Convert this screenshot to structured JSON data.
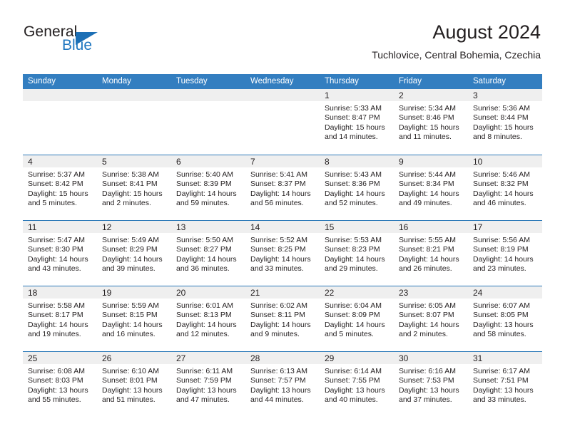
{
  "brand": {
    "name_top": "General",
    "name_bottom": "Blue",
    "accent_color": "#2077c0",
    "triangle_color": "#1c6fb5"
  },
  "header": {
    "title": "August 2024",
    "subtitle": "Tuchlovice, Central Bohemia, Czechia"
  },
  "calendar": {
    "header_background": "#337ec0",
    "header_text_color": "#ffffff",
    "day_band_background": "#efefef",
    "weekdays": [
      "Sunday",
      "Monday",
      "Tuesday",
      "Wednesday",
      "Thursday",
      "Friday",
      "Saturday"
    ],
    "weeks": [
      [
        {
          "day": "",
          "empty": true
        },
        {
          "day": "",
          "empty": true
        },
        {
          "day": "",
          "empty": true
        },
        {
          "day": "",
          "empty": true
        },
        {
          "day": "1",
          "sunrise": "Sunrise: 5:33 AM",
          "sunset": "Sunset: 8:47 PM",
          "daylight_line1": "Daylight: 15 hours",
          "daylight_line2": "and 14 minutes."
        },
        {
          "day": "2",
          "sunrise": "Sunrise: 5:34 AM",
          "sunset": "Sunset: 8:46 PM",
          "daylight_line1": "Daylight: 15 hours",
          "daylight_line2": "and 11 minutes."
        },
        {
          "day": "3",
          "sunrise": "Sunrise: 5:36 AM",
          "sunset": "Sunset: 8:44 PM",
          "daylight_line1": "Daylight: 15 hours",
          "daylight_line2": "and 8 minutes."
        }
      ],
      [
        {
          "day": "4",
          "sunrise": "Sunrise: 5:37 AM",
          "sunset": "Sunset: 8:42 PM",
          "daylight_line1": "Daylight: 15 hours",
          "daylight_line2": "and 5 minutes."
        },
        {
          "day": "5",
          "sunrise": "Sunrise: 5:38 AM",
          "sunset": "Sunset: 8:41 PM",
          "daylight_line1": "Daylight: 15 hours",
          "daylight_line2": "and 2 minutes."
        },
        {
          "day": "6",
          "sunrise": "Sunrise: 5:40 AM",
          "sunset": "Sunset: 8:39 PM",
          "daylight_line1": "Daylight: 14 hours",
          "daylight_line2": "and 59 minutes."
        },
        {
          "day": "7",
          "sunrise": "Sunrise: 5:41 AM",
          "sunset": "Sunset: 8:37 PM",
          "daylight_line1": "Daylight: 14 hours",
          "daylight_line2": "and 56 minutes."
        },
        {
          "day": "8",
          "sunrise": "Sunrise: 5:43 AM",
          "sunset": "Sunset: 8:36 PM",
          "daylight_line1": "Daylight: 14 hours",
          "daylight_line2": "and 52 minutes."
        },
        {
          "day": "9",
          "sunrise": "Sunrise: 5:44 AM",
          "sunset": "Sunset: 8:34 PM",
          "daylight_line1": "Daylight: 14 hours",
          "daylight_line2": "and 49 minutes."
        },
        {
          "day": "10",
          "sunrise": "Sunrise: 5:46 AM",
          "sunset": "Sunset: 8:32 PM",
          "daylight_line1": "Daylight: 14 hours",
          "daylight_line2": "and 46 minutes."
        }
      ],
      [
        {
          "day": "11",
          "sunrise": "Sunrise: 5:47 AM",
          "sunset": "Sunset: 8:30 PM",
          "daylight_line1": "Daylight: 14 hours",
          "daylight_line2": "and 43 minutes."
        },
        {
          "day": "12",
          "sunrise": "Sunrise: 5:49 AM",
          "sunset": "Sunset: 8:29 PM",
          "daylight_line1": "Daylight: 14 hours",
          "daylight_line2": "and 39 minutes."
        },
        {
          "day": "13",
          "sunrise": "Sunrise: 5:50 AM",
          "sunset": "Sunset: 8:27 PM",
          "daylight_line1": "Daylight: 14 hours",
          "daylight_line2": "and 36 minutes."
        },
        {
          "day": "14",
          "sunrise": "Sunrise: 5:52 AM",
          "sunset": "Sunset: 8:25 PM",
          "daylight_line1": "Daylight: 14 hours",
          "daylight_line2": "and 33 minutes."
        },
        {
          "day": "15",
          "sunrise": "Sunrise: 5:53 AM",
          "sunset": "Sunset: 8:23 PM",
          "daylight_line1": "Daylight: 14 hours",
          "daylight_line2": "and 29 minutes."
        },
        {
          "day": "16",
          "sunrise": "Sunrise: 5:55 AM",
          "sunset": "Sunset: 8:21 PM",
          "daylight_line1": "Daylight: 14 hours",
          "daylight_line2": "and 26 minutes."
        },
        {
          "day": "17",
          "sunrise": "Sunrise: 5:56 AM",
          "sunset": "Sunset: 8:19 PM",
          "daylight_line1": "Daylight: 14 hours",
          "daylight_line2": "and 23 minutes."
        }
      ],
      [
        {
          "day": "18",
          "sunrise": "Sunrise: 5:58 AM",
          "sunset": "Sunset: 8:17 PM",
          "daylight_line1": "Daylight: 14 hours",
          "daylight_line2": "and 19 minutes."
        },
        {
          "day": "19",
          "sunrise": "Sunrise: 5:59 AM",
          "sunset": "Sunset: 8:15 PM",
          "daylight_line1": "Daylight: 14 hours",
          "daylight_line2": "and 16 minutes."
        },
        {
          "day": "20",
          "sunrise": "Sunrise: 6:01 AM",
          "sunset": "Sunset: 8:13 PM",
          "daylight_line1": "Daylight: 14 hours",
          "daylight_line2": "and 12 minutes."
        },
        {
          "day": "21",
          "sunrise": "Sunrise: 6:02 AM",
          "sunset": "Sunset: 8:11 PM",
          "daylight_line1": "Daylight: 14 hours",
          "daylight_line2": "and 9 minutes."
        },
        {
          "day": "22",
          "sunrise": "Sunrise: 6:04 AM",
          "sunset": "Sunset: 8:09 PM",
          "daylight_line1": "Daylight: 14 hours",
          "daylight_line2": "and 5 minutes."
        },
        {
          "day": "23",
          "sunrise": "Sunrise: 6:05 AM",
          "sunset": "Sunset: 8:07 PM",
          "daylight_line1": "Daylight: 14 hours",
          "daylight_line2": "and 2 minutes."
        },
        {
          "day": "24",
          "sunrise": "Sunrise: 6:07 AM",
          "sunset": "Sunset: 8:05 PM",
          "daylight_line1": "Daylight: 13 hours",
          "daylight_line2": "and 58 minutes."
        }
      ],
      [
        {
          "day": "25",
          "sunrise": "Sunrise: 6:08 AM",
          "sunset": "Sunset: 8:03 PM",
          "daylight_line1": "Daylight: 13 hours",
          "daylight_line2": "and 55 minutes."
        },
        {
          "day": "26",
          "sunrise": "Sunrise: 6:10 AM",
          "sunset": "Sunset: 8:01 PM",
          "daylight_line1": "Daylight: 13 hours",
          "daylight_line2": "and 51 minutes."
        },
        {
          "day": "27",
          "sunrise": "Sunrise: 6:11 AM",
          "sunset": "Sunset: 7:59 PM",
          "daylight_line1": "Daylight: 13 hours",
          "daylight_line2": "and 47 minutes."
        },
        {
          "day": "28",
          "sunrise": "Sunrise: 6:13 AM",
          "sunset": "Sunset: 7:57 PM",
          "daylight_line1": "Daylight: 13 hours",
          "daylight_line2": "and 44 minutes."
        },
        {
          "day": "29",
          "sunrise": "Sunrise: 6:14 AM",
          "sunset": "Sunset: 7:55 PM",
          "daylight_line1": "Daylight: 13 hours",
          "daylight_line2": "and 40 minutes."
        },
        {
          "day": "30",
          "sunrise": "Sunrise: 6:16 AM",
          "sunset": "Sunset: 7:53 PM",
          "daylight_line1": "Daylight: 13 hours",
          "daylight_line2": "and 37 minutes."
        },
        {
          "day": "31",
          "sunrise": "Sunrise: 6:17 AM",
          "sunset": "Sunset: 7:51 PM",
          "daylight_line1": "Daylight: 13 hours",
          "daylight_line2": "and 33 minutes."
        }
      ]
    ]
  }
}
